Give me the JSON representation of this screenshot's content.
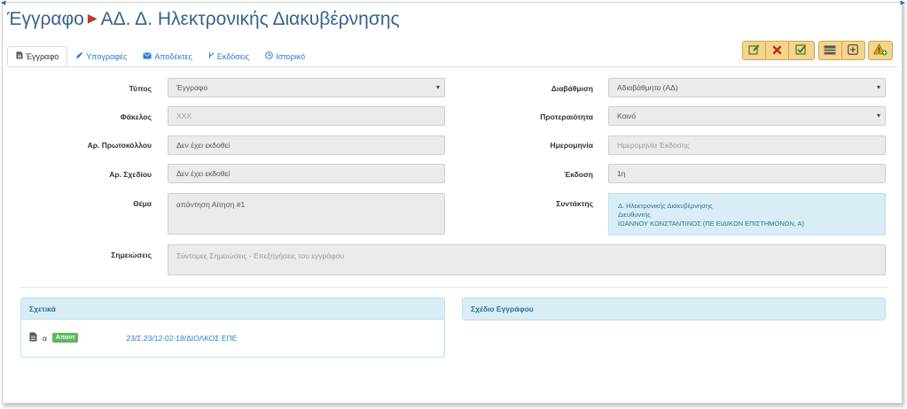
{
  "header": {
    "title_main": "Έγγραφο",
    "title_sub": "ΑΔ. Δ. Ηλεκτρονικής Διακυβέρνησης"
  },
  "tabs": [
    {
      "label": "Έγγραφο",
      "icon": "file-icon"
    },
    {
      "label": "Υπογραφές",
      "icon": "pencil-icon"
    },
    {
      "label": "Αποδέκτες",
      "icon": "envelope-icon"
    },
    {
      "label": "Εκδόσεις",
      "icon": "branch-icon"
    },
    {
      "label": "Ιστορικό",
      "icon": "clock-icon"
    }
  ],
  "toolbar": {
    "group1": [
      "edit-icon",
      "delete-icon",
      "approve-icon"
    ],
    "group2": [
      "list-icon",
      "expand-icon"
    ],
    "group3": [
      "warning-add-icon"
    ],
    "accent_color": "#f7d48b"
  },
  "form": {
    "type": {
      "label": "Τύπος",
      "value": "Έγγραφο"
    },
    "classification": {
      "label": "Διαβάθμιση",
      "value": "Αδιαβάθμητο (ΑΔ)"
    },
    "folder": {
      "label": "Φάκελος",
      "placeholder": "XXX"
    },
    "priority": {
      "label": "Προτεραιότητα",
      "value": "Κοινό"
    },
    "protocol_no": {
      "label": "Αρ. Πρωτοκόλλου",
      "value": "Δεν έχει εκδοθεί"
    },
    "date": {
      "label": "Ημερομηνία",
      "placeholder": "Ημερομηνία Έκδοσης"
    },
    "draft_no": {
      "label": "Αρ. Σχεδίου",
      "value": "Δεν έχει εκδοθεί"
    },
    "version": {
      "label": "Έκδοση",
      "value": "1η"
    },
    "subject": {
      "label": "Θέμα",
      "value": "απάντηση Αίτηση #1"
    },
    "author": {
      "label": "Συντάκτης",
      "line1": "Δ. Ηλεκτρονικής Διακυβέρνησης",
      "line2": "Διευθυντής",
      "line3": "ΙΩΑΝΝΟΥ ΚΩΝΣΤΑΝΤΙΝΟΣ (ΠΕ ΕΙΔΙΚΩΝ ΕΠΙΣΤΗΜΟΝΩΝ, Α)"
    },
    "notes": {
      "label": "Σημειώσεις",
      "placeholder": "Σύντομες Σημειώσεις - Επεξηγήσεις του εγγράφου"
    }
  },
  "related": {
    "title": "Σχετικά",
    "item": {
      "index": "α",
      "badge": "Απαντ",
      "link": "23/Σ.23/12-02-18/ΔΙΟΛΚΟΣ ΕΠΕ"
    }
  },
  "draft_panel": {
    "title": "Σχέδιο Εγγράφου"
  }
}
